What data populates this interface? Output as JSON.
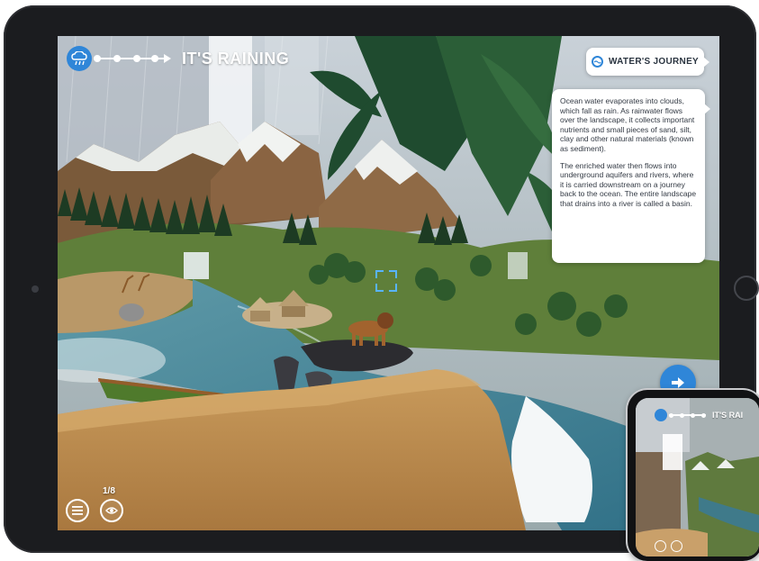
{
  "hud": {
    "stage_title": "IT'S RAINING",
    "step_counter": "1/8",
    "weather_icon": "cloud-rain-icon",
    "progress_steps_visible": 4
  },
  "journey": {
    "label": "WATER'S JOURNEY",
    "icon": "water-globe-icon"
  },
  "info_card": {
    "paragraph_1": "Ocean water evaporates into clouds, which fall as rain. As rainwater flows over the landscape, it collects important nutrients and small pieces of sand, silt, clay and other natural materials (known as sediment).",
    "paragraph_2": "The enriched water then flows into underground aquifers and rivers, where it is carried downstream on a journey back to the ocean. The entire landscape that drains into a river is called a basin."
  },
  "controls": {
    "menu_icon": "menu-icon",
    "view_icon": "eye-icon",
    "next_icon": "arrow-right-icon"
  },
  "phone": {
    "stage_title": "IT'S RAI"
  },
  "colors": {
    "accent": "#2f86d8",
    "card_bg": "#ffffff",
    "device_frame": "#1b1c1f"
  }
}
